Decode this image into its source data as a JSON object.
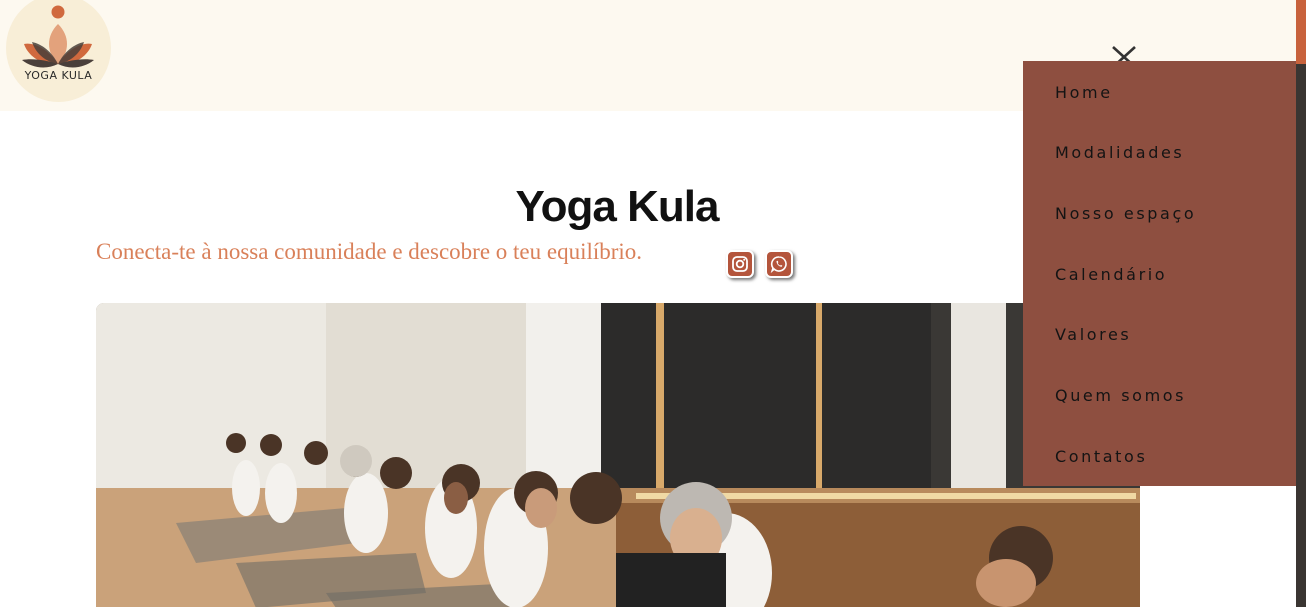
{
  "header": {
    "logo_text": "YOGA KULA",
    "close_icon": "close-x-icon"
  },
  "hero": {
    "title": "Yoga Kula",
    "subtitle": "Conecta-te à nossa comunidade e descobre o teu equilíbrio.",
    "image_description_icon": "yoga-class-photo"
  },
  "social": {
    "instagram_icon": "instagram-icon",
    "whatsapp_icon": "whatsapp-icon"
  },
  "nav": {
    "items": [
      {
        "label": "Home"
      },
      {
        "label": "Modalidades"
      },
      {
        "label": "Nosso espaço"
      },
      {
        "label": "Calendário"
      },
      {
        "label": "Valores"
      },
      {
        "label": "Quem somos"
      },
      {
        "label": "Contatos"
      }
    ]
  },
  "colors": {
    "header_bg": "#fdf9f0",
    "menu_bg": "#8e4f40",
    "accent": "#d98059",
    "social_bg": "#b4553c"
  }
}
